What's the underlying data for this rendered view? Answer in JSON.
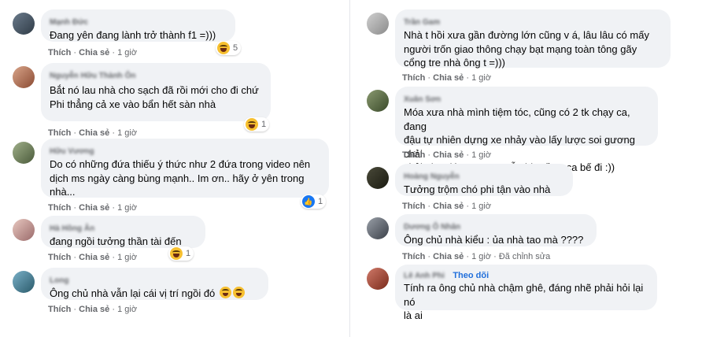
{
  "actions": {
    "like": "Thích",
    "share": "Chia sẻ",
    "sep": "·",
    "edited": "Đã chỉnh sửa"
  },
  "colors": {
    "bubble": "#f0f2f5",
    "meta": "#65676b",
    "link": "#216fdb",
    "haha": "#f7c030",
    "like": "#1877f2"
  },
  "left_comments": [
    {
      "author": "Mạnh Đức",
      "text": "Đang yên đang lành trở thành f1 =)))",
      "time": "1 giờ",
      "reaction_icon": "haha-icon",
      "reaction_count": "5"
    },
    {
      "author": "Nguyễn Hữu Thành Ôn",
      "text": "Bắt nó lau nhà cho sạch đã rồi mới cho đi chứ\nPhi thẳng cả xe vào bẩn hết sàn nhà",
      "time": "1 giờ",
      "reaction_icon": "haha-icon",
      "reaction_count": "1"
    },
    {
      "author": "Hữu Vương",
      "text": "Do có những đứa thiếu ý thức như 2 đứa trong video nên\ndịch ms ngày càng bùng mạnh.. Im ơn.. hãy ở yên trong\nnhà...",
      "time": "1 giờ",
      "reaction_icon": "like-icon",
      "reaction_count": "1"
    },
    {
      "author": "Hà Hồng Ân",
      "text": "đang ngồi tưởng thần tài đến",
      "time": "1 giờ",
      "reaction_icon": "haha-icon",
      "reaction_count": "1"
    },
    {
      "author": "Long",
      "text": "Ông chủ nhà vẫn lại cái vị trí ngồi đó",
      "time": "1 giờ",
      "inline_emoji": "haha-icon"
    }
  ],
  "right_comments": [
    {
      "author": "Trần Gam",
      "text": "Nhà t hồi xưa gần đường lớn cũng v á, lâu lâu có mấy\nngười trốn giao thông chạy bạt mạng toàn tông gãy\ncổng tre nhà ông t =)))",
      "time": "1 giờ"
    },
    {
      "author": "Xuân Sơn",
      "text": "Móa xưa nhà mình tiệm tóc, cũng có 2 tk chạy ca, đang\nđậu tự nhiên dựng xe nhảy vào lấy lược soi gương chải\nchải như đúng r, xong vẫn bị mấy a ca bế đi :))",
      "time": "1 giờ"
    },
    {
      "author": "Hoàng Nguyễn",
      "text": "Tưởng trộm chó phi tận vào nhà",
      "time": "1 giờ"
    },
    {
      "author": "Dương Ô Nhân",
      "text": "Ông chủ nhà kiểu : ủa nhà tao mà ????",
      "time": "1 giờ",
      "edited": true
    },
    {
      "author": "Lê Anh Phi",
      "follow": "Theo dõi",
      "text": "Tính ra ông chủ nhà chậm ghê, đáng nhẽ phải hỏi lại nó\nlà ai",
      "time": "1 giờ"
    }
  ]
}
